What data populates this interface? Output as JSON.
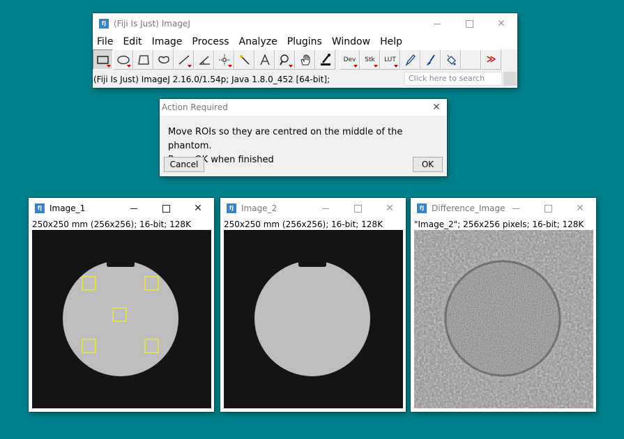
{
  "main_window": {
    "title": "(Fiji Is Just) ImageJ",
    "menu": [
      "File",
      "Edit",
      "Image",
      "Process",
      "Analyze",
      "Plugins",
      "Window",
      "Help"
    ],
    "tools": [
      {
        "icon": "rectangle-selection-icon",
        "active": true
      },
      {
        "icon": "oval-selection-icon"
      },
      {
        "icon": "polygon-selection-icon"
      },
      {
        "icon": "freehand-selection-icon"
      },
      {
        "icon": "line-tool-icon"
      },
      {
        "icon": "angle-tool-icon"
      },
      {
        "icon": "point-tool-icon"
      },
      {
        "icon": "wand-tool-icon"
      },
      {
        "icon": "text-tool-icon"
      },
      {
        "icon": "magnifier-icon"
      },
      {
        "icon": "hand-tool-icon"
      },
      {
        "icon": "dropper-tool-icon"
      },
      {
        "label": "Dev"
      },
      {
        "label": "Stk"
      },
      {
        "label": "LUT"
      },
      {
        "icon": "pencil-icon"
      },
      {
        "icon": "brush-icon"
      },
      {
        "icon": "flood-fill-icon"
      },
      {
        "icon": "blank-tool"
      },
      {
        "icon": "more-tools-icon"
      }
    ],
    "status": "(Fiji Is Just) ImageJ 2.16.0/1.54p; Java 1.8.0_452 [64-bit];",
    "search_placeholder": "Click here to search"
  },
  "dialog": {
    "title": "Action Required",
    "message_line1": "Move ROIs so they are centred on the middle of the phantom.",
    "message_line2": "Press OK when finished",
    "cancel_label": "Cancel",
    "ok_label": "OK"
  },
  "image_windows": [
    {
      "title": "Image_1",
      "info": "250x250 mm (256x256); 16-bit; 128K",
      "active": true
    },
    {
      "title": "Image_2",
      "info": "250x250 mm (256x256); 16-bit; 128K",
      "active": false
    },
    {
      "title": "Difference_Image",
      "info": "\"Image_2\"; 256x256 pixels; 16-bit; 128K",
      "active": false
    }
  ],
  "colors": {
    "desktop": "#00808a",
    "roi": "#ffff00",
    "phantom": "#bdbdbd",
    "background": "#151515"
  }
}
